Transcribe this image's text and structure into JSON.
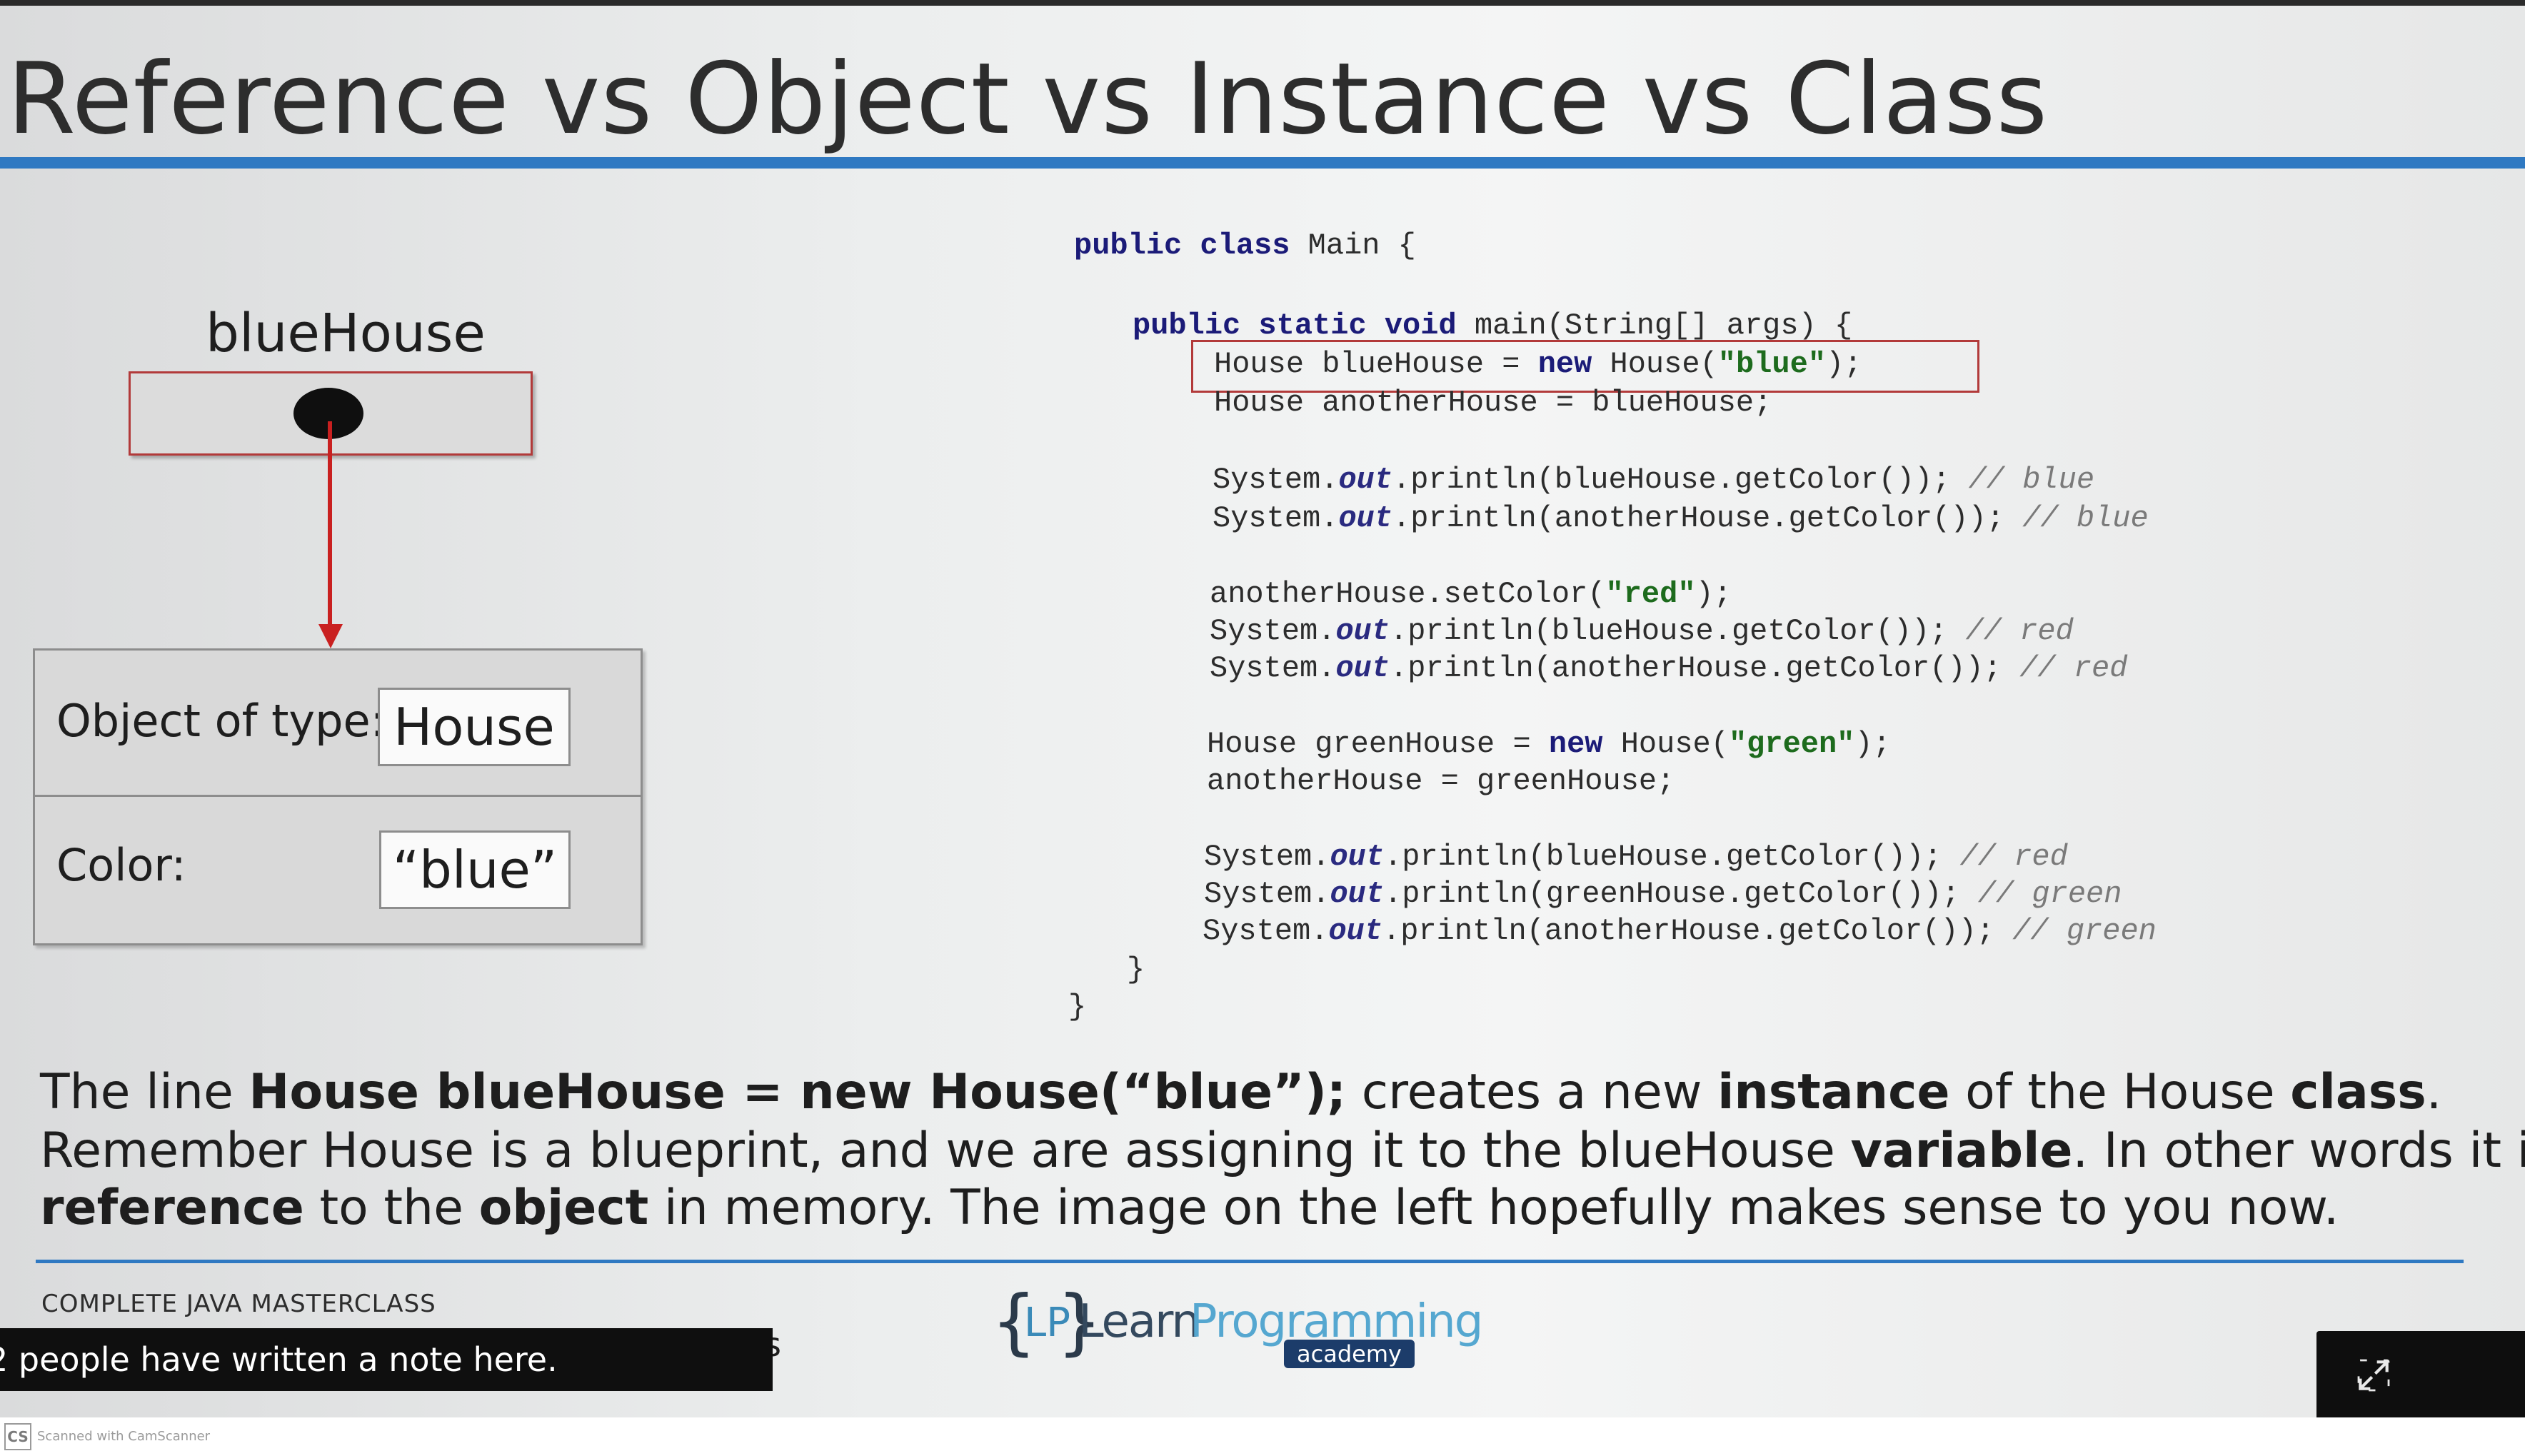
{
  "slide": {
    "title": "Reference vs Object vs Instance vs Class",
    "diagram": {
      "reference_label": "blueHouse",
      "object_type_label": "Object of type:",
      "object_type_value": "House",
      "color_label": "Color:",
      "color_value": "“blue”"
    },
    "code": [
      {
        "segments": [
          {
            "t": "public class ",
            "c": "kw"
          },
          {
            "t": "Main {",
            "c": ""
          }
        ]
      },
      {
        "segments": [
          {
            "t": "public static void ",
            "c": "kw"
          },
          {
            "t": "main(String[] args) {",
            "c": ""
          }
        ]
      },
      {
        "segments": [
          {
            "t": "House blueHouse = ",
            "c": ""
          },
          {
            "t": "new ",
            "c": "kw"
          },
          {
            "t": "House(",
            "c": ""
          },
          {
            "t": "\"blue\"",
            "c": "str"
          },
          {
            "t": ");",
            "c": ""
          }
        ]
      },
      {
        "segments": [
          {
            "t": "House anotherHouse = blueHouse;",
            "c": ""
          }
        ]
      },
      {
        "segments": [
          {
            "t": "System.",
            "c": ""
          },
          {
            "t": "out",
            "c": "fld"
          },
          {
            "t": ".println(blueHouse.getColor()); ",
            "c": ""
          },
          {
            "t": "// blue",
            "c": "cmt"
          }
        ]
      },
      {
        "segments": [
          {
            "t": "System.",
            "c": ""
          },
          {
            "t": "out",
            "c": "fld"
          },
          {
            "t": ".println(anotherHouse.getColor()); ",
            "c": ""
          },
          {
            "t": "// blue",
            "c": "cmt"
          }
        ]
      },
      {
        "segments": [
          {
            "t": "anotherHouse.setColor(",
            "c": ""
          },
          {
            "t": "\"red\"",
            "c": "str"
          },
          {
            "t": ");",
            "c": ""
          }
        ]
      },
      {
        "segments": [
          {
            "t": "System.",
            "c": ""
          },
          {
            "t": "out",
            "c": "fld"
          },
          {
            "t": ".println(blueHouse.getColor()); ",
            "c": ""
          },
          {
            "t": "// red",
            "c": "cmt"
          }
        ]
      },
      {
        "segments": [
          {
            "t": "System.",
            "c": ""
          },
          {
            "t": "out",
            "c": "fld"
          },
          {
            "t": ".println(anotherHouse.getColor()); ",
            "c": ""
          },
          {
            "t": "// red",
            "c": "cmt"
          }
        ]
      },
      {
        "segments": [
          {
            "t": "House greenHouse = ",
            "c": ""
          },
          {
            "t": "new ",
            "c": "kw"
          },
          {
            "t": "House(",
            "c": ""
          },
          {
            "t": "\"green\"",
            "c": "str"
          },
          {
            "t": ");",
            "c": ""
          }
        ]
      },
      {
        "segments": [
          {
            "t": "anotherHouse = greenHouse;",
            "c": ""
          }
        ]
      },
      {
        "segments": [
          {
            "t": "System.",
            "c": ""
          },
          {
            "t": "out",
            "c": "fld"
          },
          {
            "t": ".println(blueHouse.getColor()); ",
            "c": ""
          },
          {
            "t": "// red",
            "c": "cmt"
          }
        ]
      },
      {
        "segments": [
          {
            "t": "System.",
            "c": ""
          },
          {
            "t": "out",
            "c": "fld"
          },
          {
            "t": ".println(greenHouse.getColor()); ",
            "c": ""
          },
          {
            "t": "// green",
            "c": "cmt"
          }
        ]
      },
      {
        "segments": [
          {
            "t": "System.",
            "c": ""
          },
          {
            "t": "out",
            "c": "fld"
          },
          {
            "t": ".println(anotherHouse.getColor()); ",
            "c": ""
          },
          {
            "t": "// green",
            "c": "cmt"
          }
        ]
      },
      {
        "segments": [
          {
            "t": "}",
            "c": ""
          }
        ]
      },
      {
        "segments": [
          {
            "t": "}",
            "c": ""
          }
        ]
      }
    ],
    "explanation": [
      [
        {
          "t": "The line ",
          "b": false
        },
        {
          "t": "House blueHouse = new House(“blue”);",
          "b": true
        },
        {
          "t": "  creates a new ",
          "b": false
        },
        {
          "t": "instance",
          "b": true
        },
        {
          "t": " of the House ",
          "b": false
        },
        {
          "t": "class",
          "b": true
        },
        {
          "t": ".",
          "b": false
        }
      ],
      [
        {
          "t": "Remember House is a blueprint, and we are assigning it to the blueHouse ",
          "b": false
        },
        {
          "t": "variable",
          "b": true
        },
        {
          "t": ". In other words it is a",
          "b": false
        }
      ],
      [
        {
          "t": "reference",
          "b": true
        },
        {
          "t": " to the ",
          "b": false
        },
        {
          "t": "object",
          "b": true
        },
        {
          "t": " in memory. The image on the left hopefully makes sense to you now.",
          "b": false
        }
      ]
    ],
    "footer": "COMPLETE JAVA MASTERCLASS",
    "logo": {
      "brace_open": "{",
      "lp": "LP",
      "brace_close": "}",
      "learn": "Learn",
      "programming": "Programming",
      "academy": "academy"
    }
  },
  "overlay": {
    "notes_banner": "2 people have written a note here.",
    "stray_char": "s"
  },
  "scanner": {
    "badge": "CS",
    "text": "Scanned with CamScanner"
  },
  "colors": {
    "accent_blue": "#2f79c2",
    "highlight_red": "#b23a3a",
    "arrow_red": "#c92020"
  }
}
